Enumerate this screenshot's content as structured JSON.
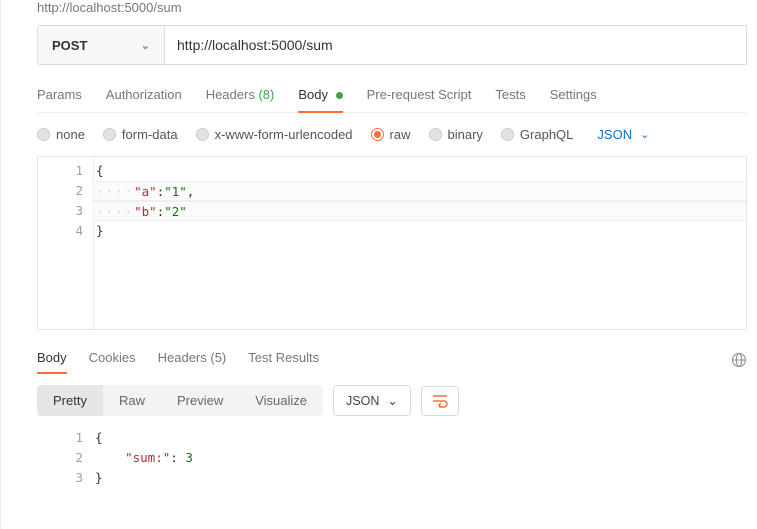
{
  "partial_url": "http://localhost:5000/sum",
  "request": {
    "method": "POST",
    "url": "http://localhost:5000/sum"
  },
  "tabs": {
    "params": "Params",
    "authorization": "Authorization",
    "headers_label": "Headers",
    "headers_count": "(8)",
    "body": "Body",
    "prerequest": "Pre-request Script",
    "tests": "Tests",
    "settings": "Settings",
    "active": "body"
  },
  "body_types": {
    "none": "none",
    "formdata": "form-data",
    "urlencoded": "x-www-form-urlencoded",
    "raw": "raw",
    "binary": "binary",
    "graphql": "GraphQL",
    "selected": "raw",
    "format_label": "JSON"
  },
  "request_body": {
    "line_numbers": [
      "1",
      "2",
      "3",
      "4"
    ],
    "lines": {
      "l1": "{",
      "l2_dots": "····",
      "l2_key": "\"a\"",
      "l2_sep": ":",
      "l2_val": "\"1\"",
      "l2_end": ",",
      "l3_dots": "····",
      "l3_key": "\"b\"",
      "l3_sep": ":",
      "l3_val": "\"2\"",
      "l4": "}"
    }
  },
  "response_tabs": {
    "body": "Body",
    "cookies": "Cookies",
    "headers_label": "Headers",
    "headers_count": "(5)",
    "test_results": "Test Results",
    "active": "body"
  },
  "response_view": {
    "pretty": "Pretty",
    "raw": "Raw",
    "preview": "Preview",
    "visualize": "Visualize",
    "format_label": "JSON"
  },
  "response_body": {
    "line_numbers": [
      "1",
      "2",
      "3"
    ],
    "lines": {
      "l1": "{",
      "l2_indent": "    ",
      "l2_key": "\"sum:\"",
      "l2_sep": ": ",
      "l2_val": "3",
      "l3": "}"
    }
  }
}
